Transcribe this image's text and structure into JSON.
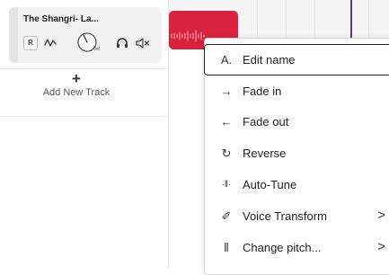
{
  "track": {
    "name": "The Shangri- La...",
    "record_label": "R",
    "volume_label": "Vol"
  },
  "add_track": {
    "plus": "+",
    "label": "Add New Track"
  },
  "context_menu": {
    "items": [
      {
        "icon": "A.",
        "label": "Edit name",
        "submenu": false,
        "selected": true
      },
      {
        "icon": "→",
        "label": "Fade in",
        "submenu": false
      },
      {
        "icon": "←",
        "label": "Fade out",
        "submenu": false
      },
      {
        "icon": "↻",
        "label": "Reverse",
        "submenu": false
      },
      {
        "icon": "·‖·",
        "label": "Auto-Tune",
        "submenu": false
      },
      {
        "icon": "✐",
        "label": "Voice Transform",
        "submenu": true,
        "chevron": ">"
      },
      {
        "icon": "⫴",
        "label": "Change pitch...",
        "submenu": true,
        "chevron": ">"
      }
    ]
  },
  "colors": {
    "clip": "#d9223f",
    "playhead": "#5a3a7a"
  }
}
